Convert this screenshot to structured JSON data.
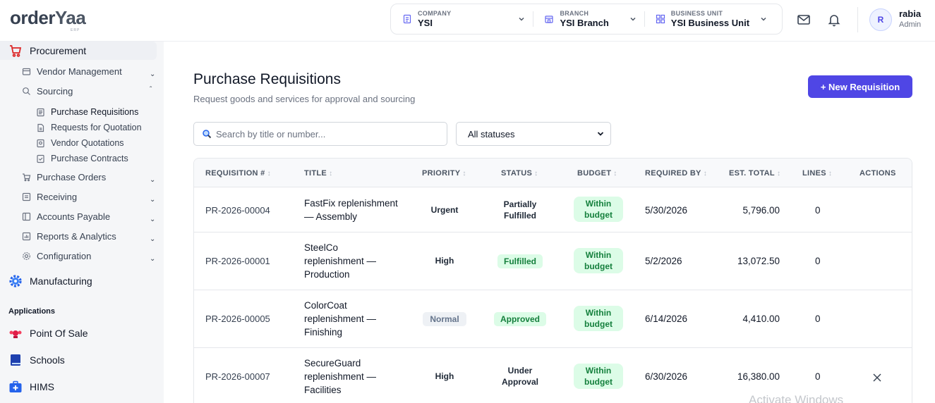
{
  "brand": {
    "name_part1": "order",
    "name_part2": "Yaa",
    "tagline": "ERP"
  },
  "context": {
    "company": {
      "label": "COMPANY",
      "value": "YSI"
    },
    "branch": {
      "label": "BRANCH",
      "value": "YSI Branch"
    },
    "business_unit": {
      "label": "BUSINESS UNIT",
      "value": "YSI Business Unit"
    }
  },
  "user": {
    "initial": "R",
    "name": "rabia",
    "role": "Admin"
  },
  "sidebar": {
    "procurement": "Procurement",
    "vendor_management": "Vendor Management",
    "sourcing": "Sourcing",
    "sourcing_items": [
      "Purchase Requisitions",
      "Requests for Quotation",
      "Vendor Quotations",
      "Purchase Contracts"
    ],
    "purchase_orders": "Purchase Orders",
    "receiving": "Receiving",
    "accounts_payable": "Accounts Payable",
    "reports": "Reports & Analytics",
    "configuration": "Configuration",
    "manufacturing": "Manufacturing",
    "applications_heading": "Applications",
    "apps": [
      "Point Of Sale",
      "Schools",
      "HIMS"
    ]
  },
  "page": {
    "title": "Purchase Requisitions",
    "subtitle": "Request goods and services for approval and sourcing",
    "new_button": "+ New Requisition"
  },
  "filters": {
    "search_placeholder": "Search by title or number...",
    "status_selected": "All statuses"
  },
  "table": {
    "headers": [
      "REQUISITION #",
      "TITLE",
      "PRIORITY",
      "STATUS",
      "BUDGET",
      "REQUIRED BY",
      "EST. TOTAL",
      "LINES",
      "ACTIONS"
    ],
    "rows": [
      {
        "number": "PR-2026-00004",
        "title": "FastFix replenishment — Assembly",
        "priority": "Urgent",
        "status": "Partially Fulfilled",
        "budget": "Within budget",
        "required_by": "5/30/2026",
        "est_total": "5,796.00",
        "lines": "0"
      },
      {
        "number": "PR-2026-00001",
        "title": "SteelCo replenishment — Production",
        "priority": "High",
        "status": "Fulfilled",
        "budget": "Within budget",
        "required_by": "5/2/2026",
        "est_total": "13,072.50",
        "lines": "0"
      },
      {
        "number": "PR-2026-00005",
        "title": "ColorCoat replenishment — Finishing",
        "priority": "Normal",
        "status": "Approved",
        "budget": "Within budget",
        "required_by": "6/14/2026",
        "est_total": "4,410.00",
        "lines": "0"
      },
      {
        "number": "PR-2026-00007",
        "title": "SecureGuard replenishment — Facilities",
        "priority": "High",
        "status": "Under Approval",
        "budget": "Within budget",
        "required_by": "6/30/2026",
        "est_total": "16,380.00",
        "lines": "0"
      }
    ]
  },
  "watermark": "Activate Windows",
  "colors": {
    "accent": "#4f46e5",
    "success_bg": "#dcfce7",
    "success_text": "#15803d",
    "brand_red": "#dc2626"
  }
}
